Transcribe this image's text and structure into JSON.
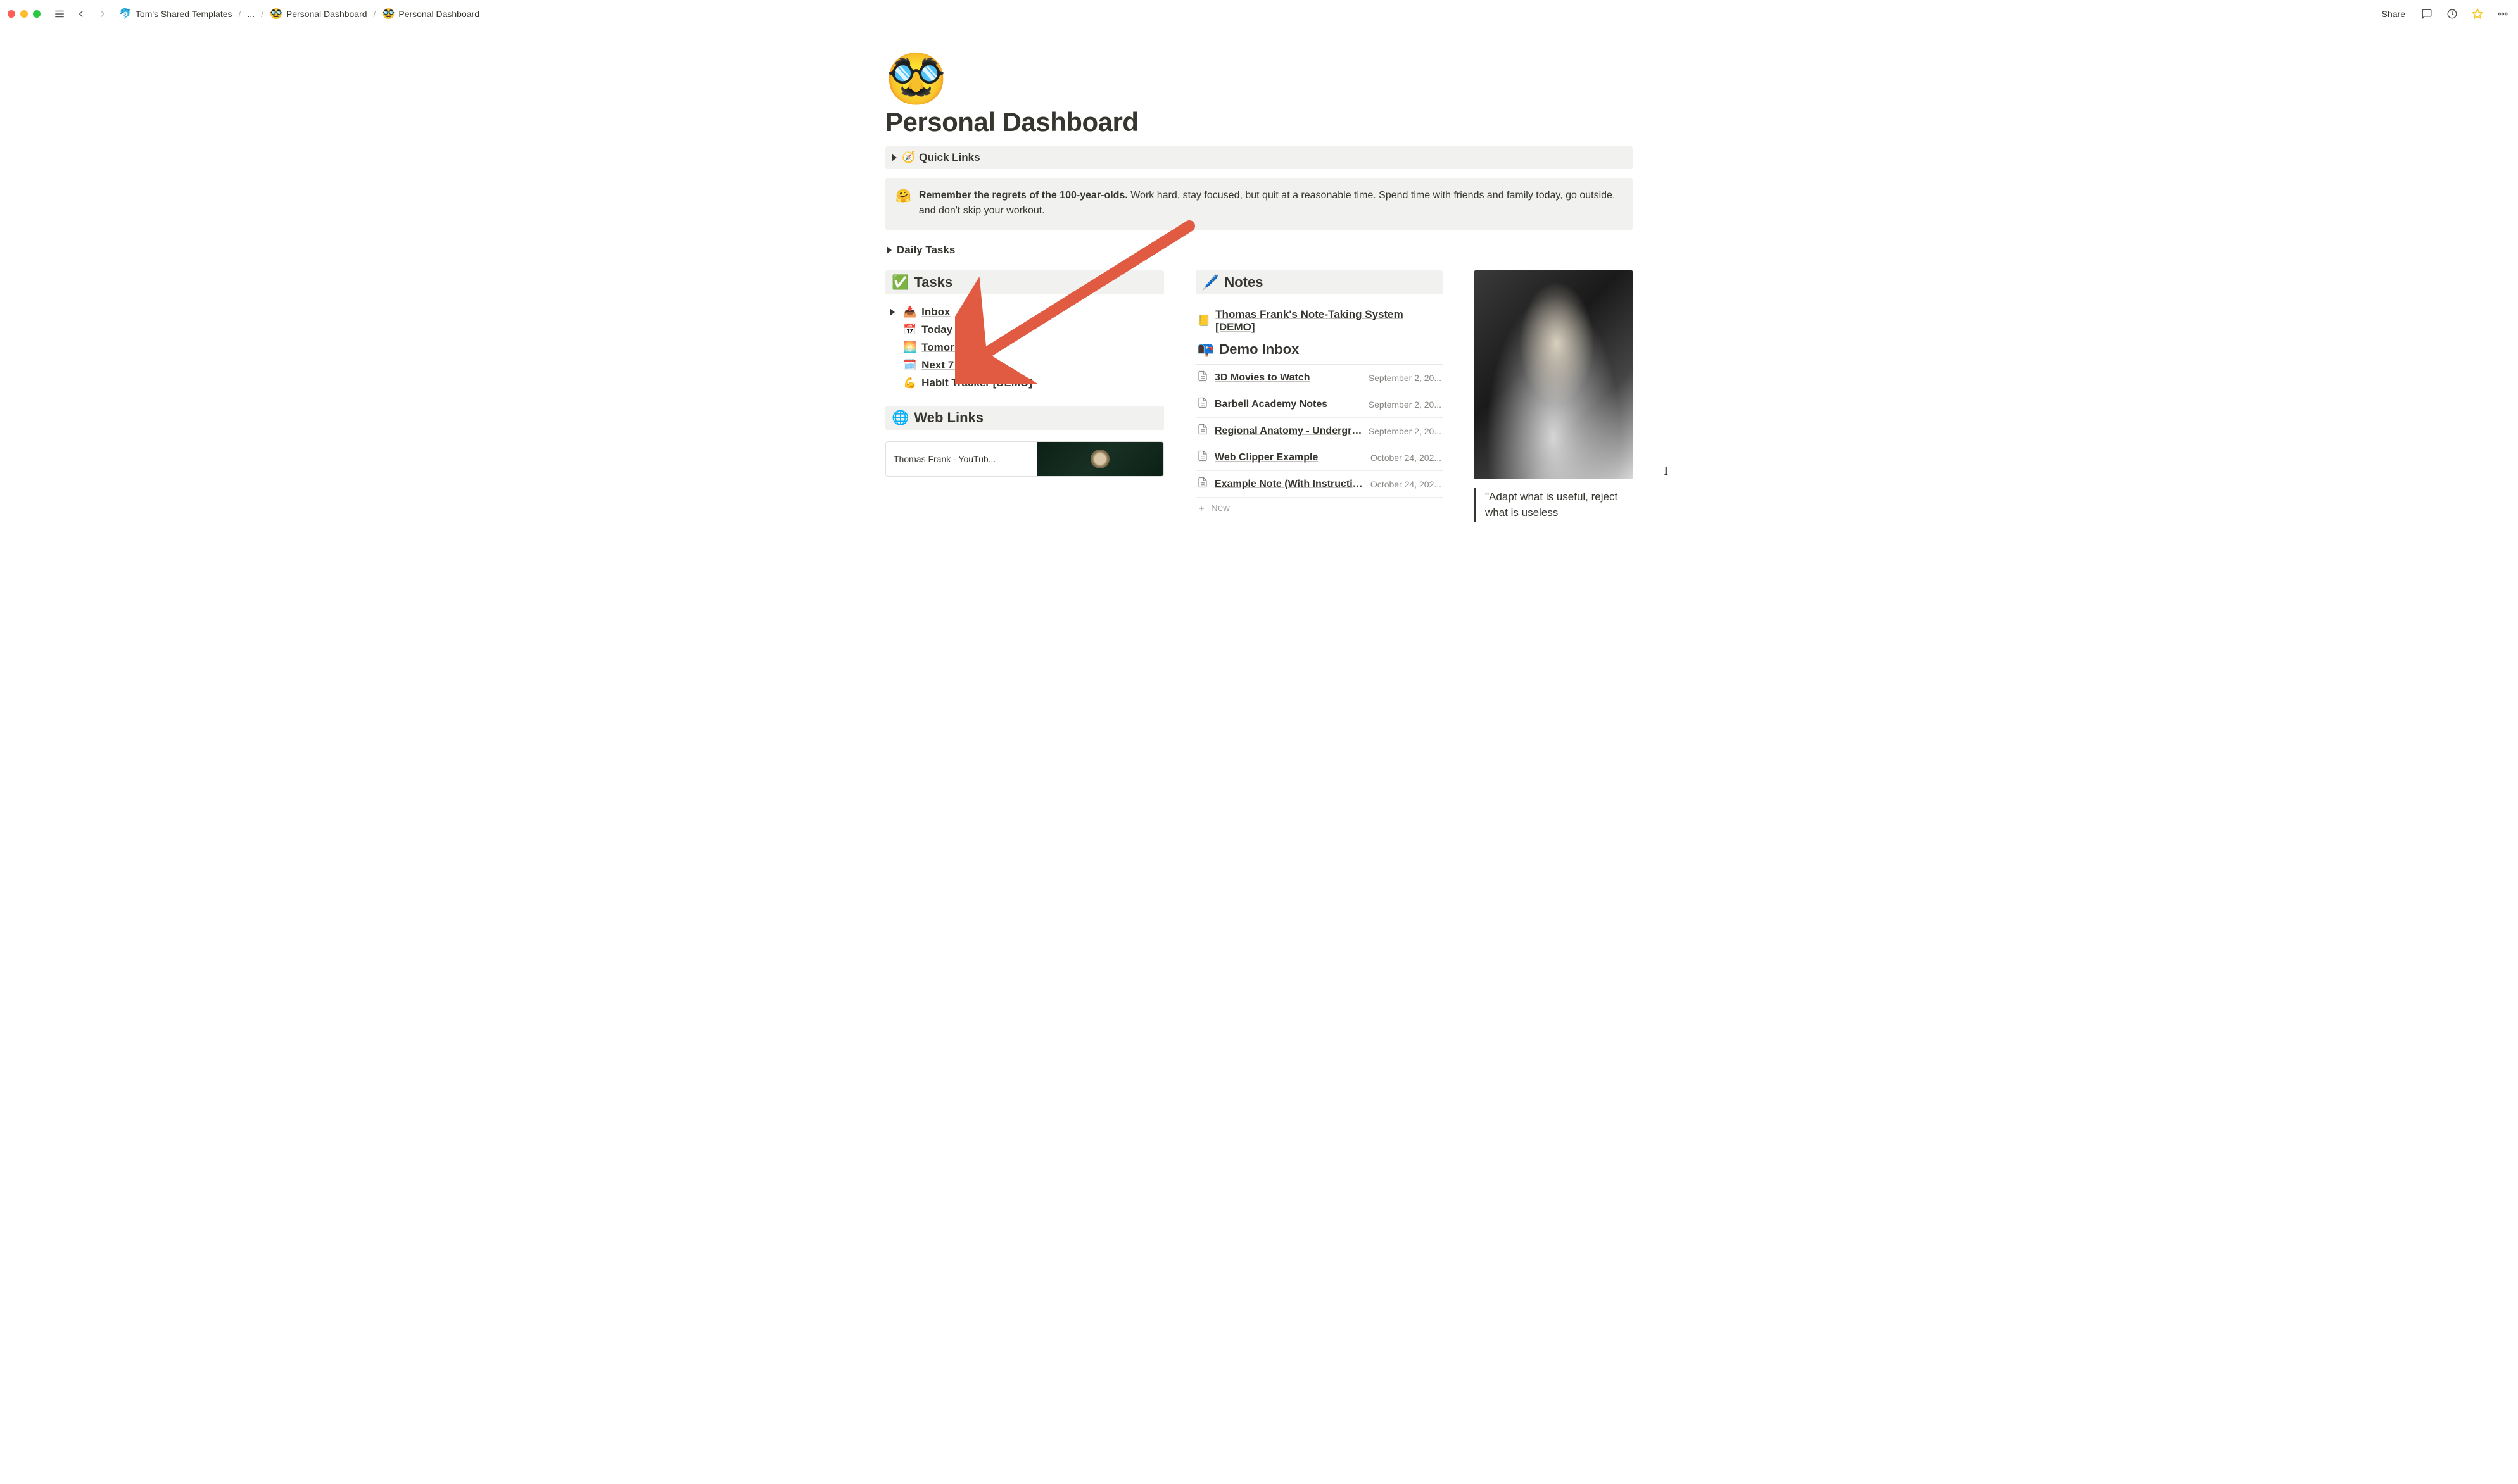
{
  "window": {
    "traffic": {
      "close": "close",
      "min": "minimize",
      "max": "maximize"
    }
  },
  "topbar": {
    "share_label": "Share"
  },
  "breadcrumbs": {
    "items": [
      {
        "emoji": "🐬",
        "label": "Tom's Shared Templates"
      },
      {
        "emoji": "",
        "label": "..."
      },
      {
        "emoji": "🥸",
        "label": "Personal Dashboard"
      },
      {
        "emoji": "🥸",
        "label": "Personal Dashboard"
      }
    ]
  },
  "page": {
    "emoji": "🥸",
    "title": "Personal Dashboard"
  },
  "quick_links": {
    "emoji": "🧭",
    "label": "Quick Links"
  },
  "callout": {
    "emoji": "🤗",
    "bold": "Remember the regrets of the 100-year-olds.",
    "rest": " Work hard, stay focused, but quit at a reasonable time. Spend time with friends and family today, go outside, and don't skip your workout."
  },
  "daily_tasks": {
    "label": "Daily Tasks"
  },
  "tasks": {
    "header_emoji": "✅",
    "header_label": "Tasks",
    "items": [
      {
        "emoji": "📥",
        "label": "Inbox",
        "has_caret": true
      },
      {
        "emoji": "📅",
        "label": "Today",
        "has_caret": false
      },
      {
        "emoji": "🌅",
        "label": "Tomorrow",
        "has_caret": false
      },
      {
        "emoji": "🗓️",
        "label": "Next 7 Days",
        "has_caret": false
      },
      {
        "emoji": "💪",
        "label": "Habit Tracker [DEMO]",
        "has_caret": false
      }
    ]
  },
  "weblinks": {
    "emoji": "🌐",
    "label": "Web Links",
    "bookmark_title": "Thomas Frank - YouTub..."
  },
  "notes": {
    "header_emoji": "🖊️",
    "header_label": "Notes",
    "system_link_emoji": "📒",
    "system_link_label": "Thomas Frank's Note-Taking System [DEMO]",
    "inbox_emoji": "📭",
    "inbox_label": "Demo Inbox",
    "rows": [
      {
        "title": "3D Movies to Watch",
        "date": "September 2, 20..."
      },
      {
        "title": "Barbell Academy Notes",
        "date": "September 2, 20..."
      },
      {
        "title": "Regional Anatomy - Undergrad...",
        "date": "September 2, 20..."
      },
      {
        "title": "Web Clipper Example",
        "date": "October 24, 202..."
      },
      {
        "title": "Example Note (With Instruction...",
        "date": "October 24, 202..."
      }
    ],
    "new_label": "New"
  },
  "quote": {
    "text": "\"Adapt what is useful, reject what is useless"
  },
  "colors": {
    "arrow": "#e15b43",
    "star": "#f5c518",
    "bg_block": "#f1f1ef"
  }
}
